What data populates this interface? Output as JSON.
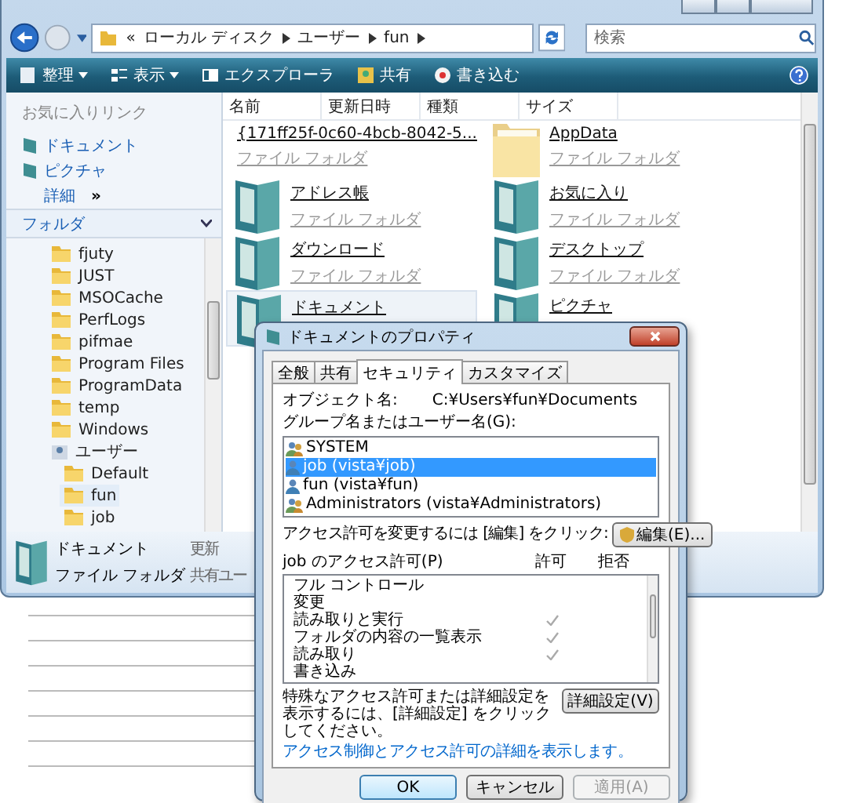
{
  "explorer": {
    "address": {
      "overflow": "«",
      "segments": [
        "ローカル ディスク",
        "ユーザー",
        "fun"
      ]
    },
    "search": {
      "placeholder": "検索"
    },
    "toolbar": [
      {
        "label": "整理",
        "kind": "menu"
      },
      {
        "label": "表示",
        "kind": "menu"
      },
      {
        "label": "エクスプローラ",
        "kind": "plain"
      },
      {
        "label": "共有",
        "kind": "plain"
      },
      {
        "label": "書き込む",
        "kind": "plain"
      }
    ],
    "favorites": {
      "title": "お気に入りリンク",
      "links": [
        "ドキュメント",
        "ピクチャ"
      ],
      "more": "詳細",
      "more_icon": "»"
    },
    "folders": {
      "title": "フォルダ",
      "tree": [
        {
          "label": "fjuty",
          "selected": false
        },
        {
          "label": "JUST",
          "selected": false
        },
        {
          "label": "MSOCache",
          "selected": false
        },
        {
          "label": "PerfLogs",
          "selected": false
        },
        {
          "label": "pifmae",
          "selected": false
        },
        {
          "label": "Program Files",
          "selected": false
        },
        {
          "label": "ProgramData",
          "selected": false
        },
        {
          "label": "temp",
          "selected": false
        },
        {
          "label": "Windows",
          "selected": false
        },
        {
          "label": "ユーザー",
          "selected": false,
          "children": [
            {
              "label": "Default",
              "selected": false
            },
            {
              "label": "fun",
              "selected": true
            },
            {
              "label": "job",
              "selected": false
            }
          ]
        }
      ]
    },
    "columns": [
      "名前",
      "更新日時",
      "種類",
      "サイズ"
    ],
    "items": [
      {
        "name": "{171ff25f-0c60-4bcb-8042-5...",
        "type": "ファイル フォルダ",
        "kind": "plain",
        "selected": false
      },
      {
        "name": "AppData",
        "type": "ファイル フォルダ",
        "kind": "faded",
        "selected": false
      },
      {
        "name": "アドレス帳",
        "type": "ファイル フォルダ",
        "kind": "library",
        "selected": false
      },
      {
        "name": "お気に入り",
        "type": "ファイル フォルダ",
        "kind": "library",
        "selected": false
      },
      {
        "name": "ダウンロード",
        "type": "ファイル フォルダ",
        "kind": "library",
        "selected": false
      },
      {
        "name": "デスクトップ",
        "type": "ファイル フォルダ",
        "kind": "library",
        "selected": false
      },
      {
        "name": "ドキュメント",
        "kind": "library",
        "selected": true
      },
      {
        "name": "ピクチャ",
        "kind": "library",
        "selected": false
      }
    ],
    "details": {
      "name": "ドキュメント",
      "type": "ファイル フォルダ",
      "field_1": "更新",
      "field_2": "共有ユー"
    }
  },
  "dialog": {
    "title": "ドキュメントのプロパティ",
    "tabs": [
      {
        "label": "全般",
        "selected": false
      },
      {
        "label": "共有",
        "selected": false
      },
      {
        "label": "セキュリティ",
        "selected": true
      },
      {
        "label": "カスタマイズ",
        "selected": false
      }
    ],
    "object_label": "オブジェクト名:",
    "object_value": "C:¥Users¥fun¥Documents",
    "groups_label": "グループ名またはユーザー名(G):",
    "groups": [
      {
        "name": "SYSTEM",
        "kind": "group",
        "selected": false
      },
      {
        "name": "job (vista¥job)",
        "kind": "user",
        "selected": true
      },
      {
        "name": "fun (vista¥fun)",
        "kind": "user",
        "selected": false
      },
      {
        "name": "Administrators (vista¥Administrators)",
        "kind": "group",
        "selected": false
      }
    ],
    "edit_hint": "アクセス許可を変更するには [編集] をクリック:",
    "edit_button": "編集(E)...",
    "perm_label": "job のアクセス許可(P)",
    "allow_header": "許可",
    "deny_header": "拒否",
    "permissions": [
      {
        "name": "フル コントロール",
        "allow": false
      },
      {
        "name": "変更",
        "allow": false
      },
      {
        "name": "読み取りと実行",
        "allow": true
      },
      {
        "name": "フォルダの内容の一覧表示",
        "allow": true
      },
      {
        "name": "読み取り",
        "allow": true
      },
      {
        "name": "書き込み",
        "allow": false
      }
    ],
    "advanced_hint": "特殊なアクセス許可または詳細設定を表示するには、[詳細設定] をクリックしてください。",
    "advanced_button": "詳細設定(V)",
    "help_link": "アクセス制御とアクセス許可の詳細を表示します。",
    "buttons": [
      {
        "label": "OK",
        "disabled": false
      },
      {
        "label": "キャンセル",
        "disabled": false
      },
      {
        "label": "適用(A)",
        "disabled": true
      }
    ]
  }
}
